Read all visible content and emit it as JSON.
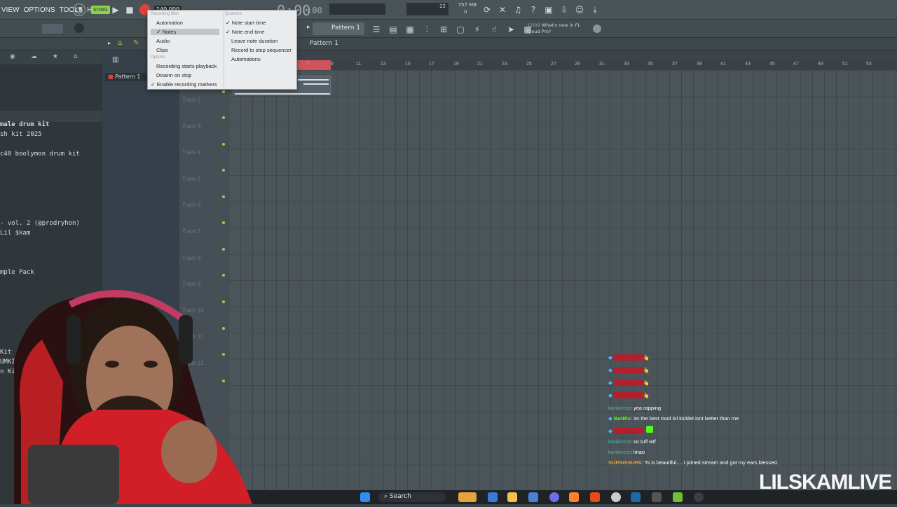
{
  "menu": [
    "VIEW",
    "OPTIONS",
    "TOOLS",
    "HELP"
  ],
  "transport": {
    "song_badge": "SONG",
    "time": "0:00",
    "time_small": ":00",
    "tempo": "140.000",
    "mem_value": "22",
    "mem_size": "757 MB",
    "mem_sub": "0"
  },
  "news": {
    "date": "12/09",
    "text": "What's new in FL Cloud Pro?"
  },
  "pattern_selector": "Pattern 1",
  "breadcrumb": "Pattern 1",
  "pattern_list_item": "Pattern 1",
  "browser_items": [
    "male drum kit",
    "sh kit 2025",
    "c40 boolymon drum kit",
    "- vol. 2 (@prodryhon)",
    "Lil $kam",
    "mple Pack",
    "Kit",
    "UMKIT",
    "n Kit)"
  ],
  "tracks": [
    "Track 2",
    "Track 3",
    "Track 4",
    "Track 5",
    "Track 6",
    "Track 7",
    "Track 8",
    "Track 9",
    "Track 10",
    "Track 11",
    "Track 12"
  ],
  "ruler_numbers": [
    "7",
    "9",
    "11",
    "13",
    "15",
    "17",
    "19",
    "21",
    "23",
    "25",
    "27",
    "29",
    "31",
    "33",
    "35",
    "37",
    "39",
    "41",
    "43",
    "45",
    "47",
    "49",
    "51",
    "53"
  ],
  "dropdown": {
    "header_left": "Recording filter",
    "header_right": "Quantize",
    "options_header": "Options",
    "filter_items": [
      {
        "label": "Automation",
        "checked": false
      },
      {
        "label": "Notes",
        "checked": true
      },
      {
        "label": "Audio",
        "checked": false
      },
      {
        "label": "Clips",
        "checked": false
      }
    ],
    "quantize_items": [
      {
        "label": "Note start time",
        "checked": true
      },
      {
        "label": "Note end time",
        "checked": true
      },
      {
        "label": "Leave note duration",
        "checked": false
      },
      {
        "label": "Record to step sequencer",
        "checked": false
      },
      {
        "label": "Automations",
        "checked": false
      }
    ],
    "option_items": [
      {
        "label": "Recording starts playback",
        "checked": false
      },
      {
        "label": "Disarm on stop",
        "checked": false
      },
      {
        "label": "Enable recording markers",
        "checked": true
      }
    ]
  },
  "chat": [
    {
      "user": "",
      "msg": "👆",
      "color": "#b1202c"
    },
    {
      "user": "",
      "msg": "👆",
      "color": "#b1202c"
    },
    {
      "user": "",
      "msg": "👆",
      "color": "#b1202c"
    },
    {
      "user": "",
      "msg": "👆",
      "color": "#b1202c"
    },
    {
      "user": "konkorror",
      "msg": ": yea rapping",
      "color": "#4fb7a8"
    },
    {
      "user": "BotRix",
      "msg": ": im the best mod lol kicklet isnt better than me",
      "color": "#53fc18"
    },
    {
      "user": "",
      "msg": "",
      "color": "#b1202c"
    },
    {
      "user": "konkorror",
      "msg": ": so tuff wtf",
      "color": "#4fb7a8"
    },
    {
      "user": "konkorror",
      "msg": ": lmao",
      "color": "#4fb7a8"
    },
    {
      "user": "SUPAISSUPA",
      "msg": ": Ts is beautiful.....I joined stream and got my ears blessed.",
      "color": "#f0a020"
    }
  ],
  "taskbar": {
    "search_label": "Search"
  },
  "watermark": "LILSKAMLIVE",
  "colors": {
    "accent_record": "#e0413b",
    "accent_song": "#8fd14f",
    "track_dot": "#8fd14f"
  }
}
